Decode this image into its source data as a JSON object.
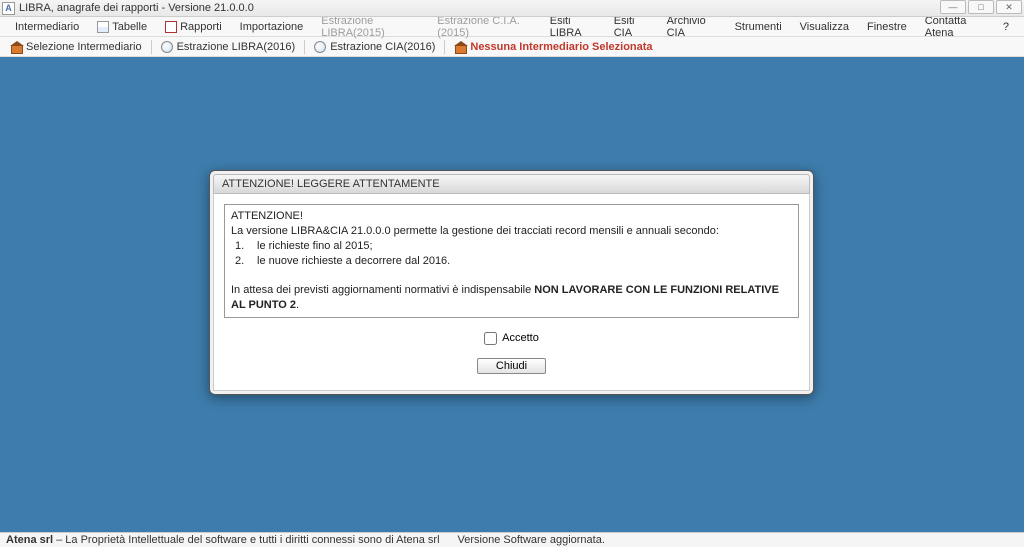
{
  "window": {
    "app_icon_letter": "A",
    "title": "LIBRA, anagrafe dei rapporti - Versione 21.0.0.0"
  },
  "menubar": {
    "intermediario": "Intermediario",
    "tabelle": "Tabelle",
    "rapporti": "Rapporti",
    "importazione": "Importazione",
    "estrazione_libra_2015": "Estrazione LIBRA(2015)",
    "estrazione_cia_2015": "Estrazione C.I.A.(2015)",
    "esiti_libra": "Esiti LIBRA",
    "esiti_cia": "Esiti CIA",
    "archivio_cia": "Archivio CIA",
    "strumenti": "Strumenti",
    "visualizza": "Visualizza",
    "finestre": "Finestre",
    "contatta_atena": "Contatta Atena",
    "help": "?"
  },
  "toolbar": {
    "selezione_intermediario": "Selezione Intermediario",
    "estrazione_libra_2016": "Estrazione LIBRA(2016)",
    "estrazione_cia_2016": "Estrazione CIA(2016)",
    "warning": "Nessuna Intermediario Selezionata"
  },
  "dialog": {
    "title": "ATTENZIONE! LEGGERE ATTENTAMENTE",
    "heading": "ATTENZIONE!",
    "intro": "La versione LIBRA&CIA 21.0.0.0 permette la gestione dei tracciati record mensili e annuali secondo:",
    "item1_num": "1.",
    "item1_text": "le richieste fino al 2015;",
    "item2_num": "2.",
    "item2_text": "le nuove richieste a decorrere dal 2016.",
    "note_prefix": "In attesa dei previsti aggiornamenti normativi è indispensabile ",
    "note_bold": "NON LAVORARE CON LE FUNZIONI RELATIVE AL PUNTO 2",
    "note_suffix": ".",
    "accept_label": "Accetto",
    "close_label": "Chiudi"
  },
  "statusbar": {
    "company": "Atena srl",
    "copyright": " – La Proprietà Intellettuale del software e tutti i diritti connessi sono di Atena srl",
    "version_msg": "Versione Software aggiornata."
  }
}
